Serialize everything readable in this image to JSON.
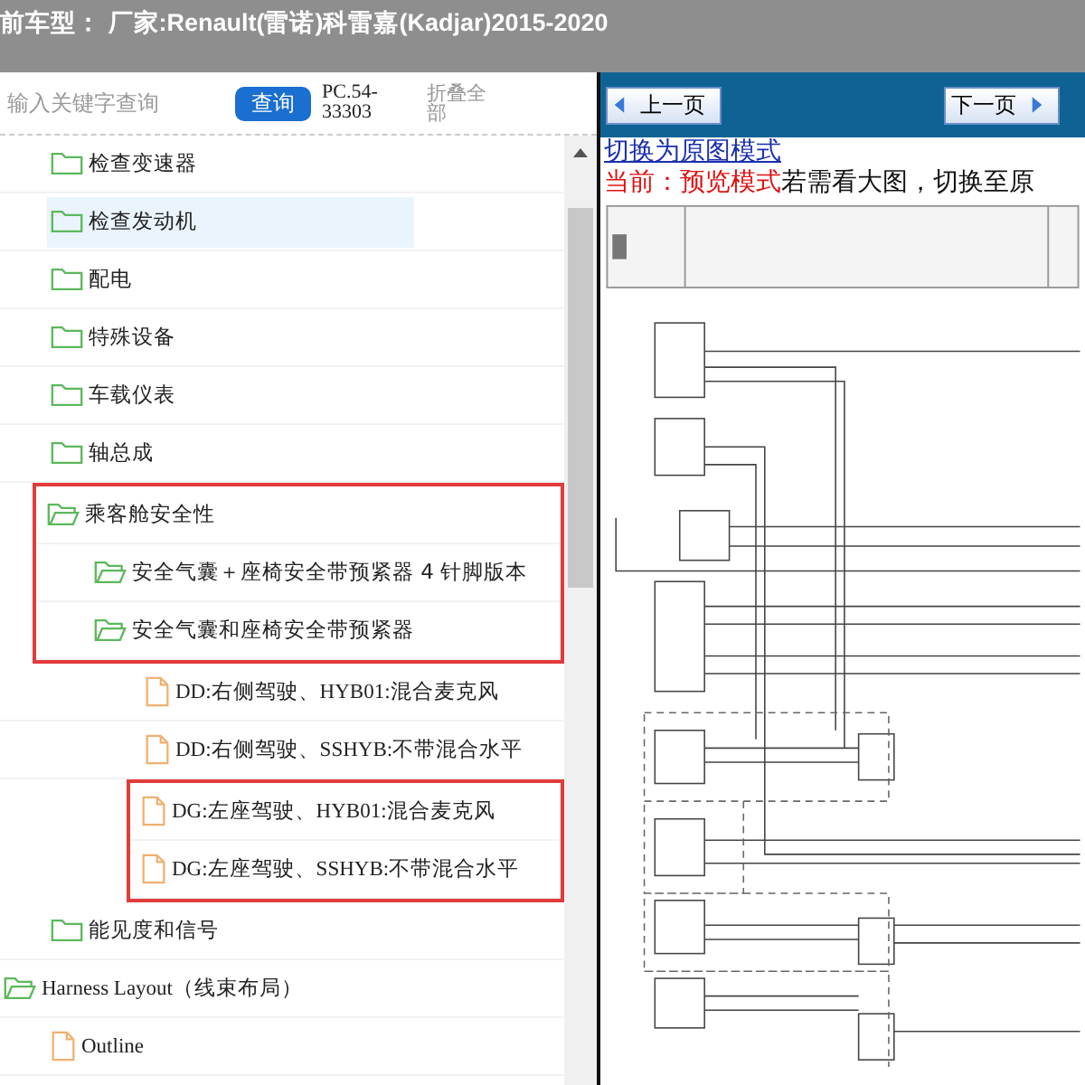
{
  "title_bar": {
    "text": "前车型：  厂家:Renault(雷诺)科雷嘉(Kadjar)2015-2020"
  },
  "search": {
    "placeholder": "输入关键字查询",
    "button": "查询",
    "code": "PC.54-33303",
    "collapse": "折叠全部"
  },
  "tree": [
    {
      "expanded": true,
      "children": [
        {
          "label": "检查变速器",
          "kind": "folder",
          "expanded": false,
          "selected": false,
          "highlighted": false
        },
        {
          "label": "检查发动机",
          "kind": "folder",
          "expanded": false,
          "selected": true,
          "highlighted": false
        },
        {
          "label": "配电",
          "kind": "folder",
          "expanded": false,
          "selected": false,
          "highlighted": false
        },
        {
          "label": "特殊设备",
          "kind": "folder",
          "expanded": false,
          "selected": false,
          "highlighted": false
        },
        {
          "label": "车载仪表",
          "kind": "folder",
          "expanded": false,
          "selected": false,
          "highlighted": false
        },
        {
          "label": "轴总成",
          "kind": "folder",
          "expanded": false,
          "selected": false,
          "highlighted": false
        },
        {
          "label": "乘客舱安全性",
          "kind": "folder",
          "expanded": true,
          "selected": false,
          "highlighted": true,
          "children": [
            {
              "label": "安全气囊＋座椅安全带预紧器 4 针脚版本",
              "kind": "folder",
              "expanded": true,
              "selected": false,
              "highlighted": true
            },
            {
              "label": "安全气囊和座椅安全带预紧器",
              "kind": "folder",
              "expanded": true,
              "selected": false,
              "highlighted": true,
              "children": [
                {
                  "label": "DD:右侧驾驶、HYB01:混合麦克风",
                  "kind": "document",
                  "selected": false,
                  "highlighted": false
                },
                {
                  "label": "DD:右侧驾驶、SSHYB:不带混合水平",
                  "kind": "document",
                  "selected": false,
                  "highlighted": false
                },
                {
                  "label": "DG:左座驾驶、HYB01:混合麦克风",
                  "kind": "document",
                  "selected": false,
                  "highlighted": true
                },
                {
                  "label": "DG:左座驾驶、SSHYB:不带混合水平",
                  "kind": "document",
                  "selected": false,
                  "highlighted": true
                }
              ]
            }
          ]
        },
        {
          "label": "能见度和信号",
          "kind": "folder",
          "expanded": false,
          "selected": false,
          "highlighted": false
        }
      ]
    },
    {
      "label": "Harness Layout（线束布局）",
      "kind": "folder",
      "expanded": true,
      "selected": false,
      "highlighted": false,
      "children": [
        {
          "label": "Outline",
          "kind": "document",
          "selected": false,
          "highlighted": false
        }
      ]
    }
  ],
  "viewer": {
    "prev": "上一页",
    "next": "下一页",
    "switch_link": "切换为原图模式",
    "mode_label": "当前：预览模式",
    "mode_hint": "若需看大图，切换至原"
  }
}
